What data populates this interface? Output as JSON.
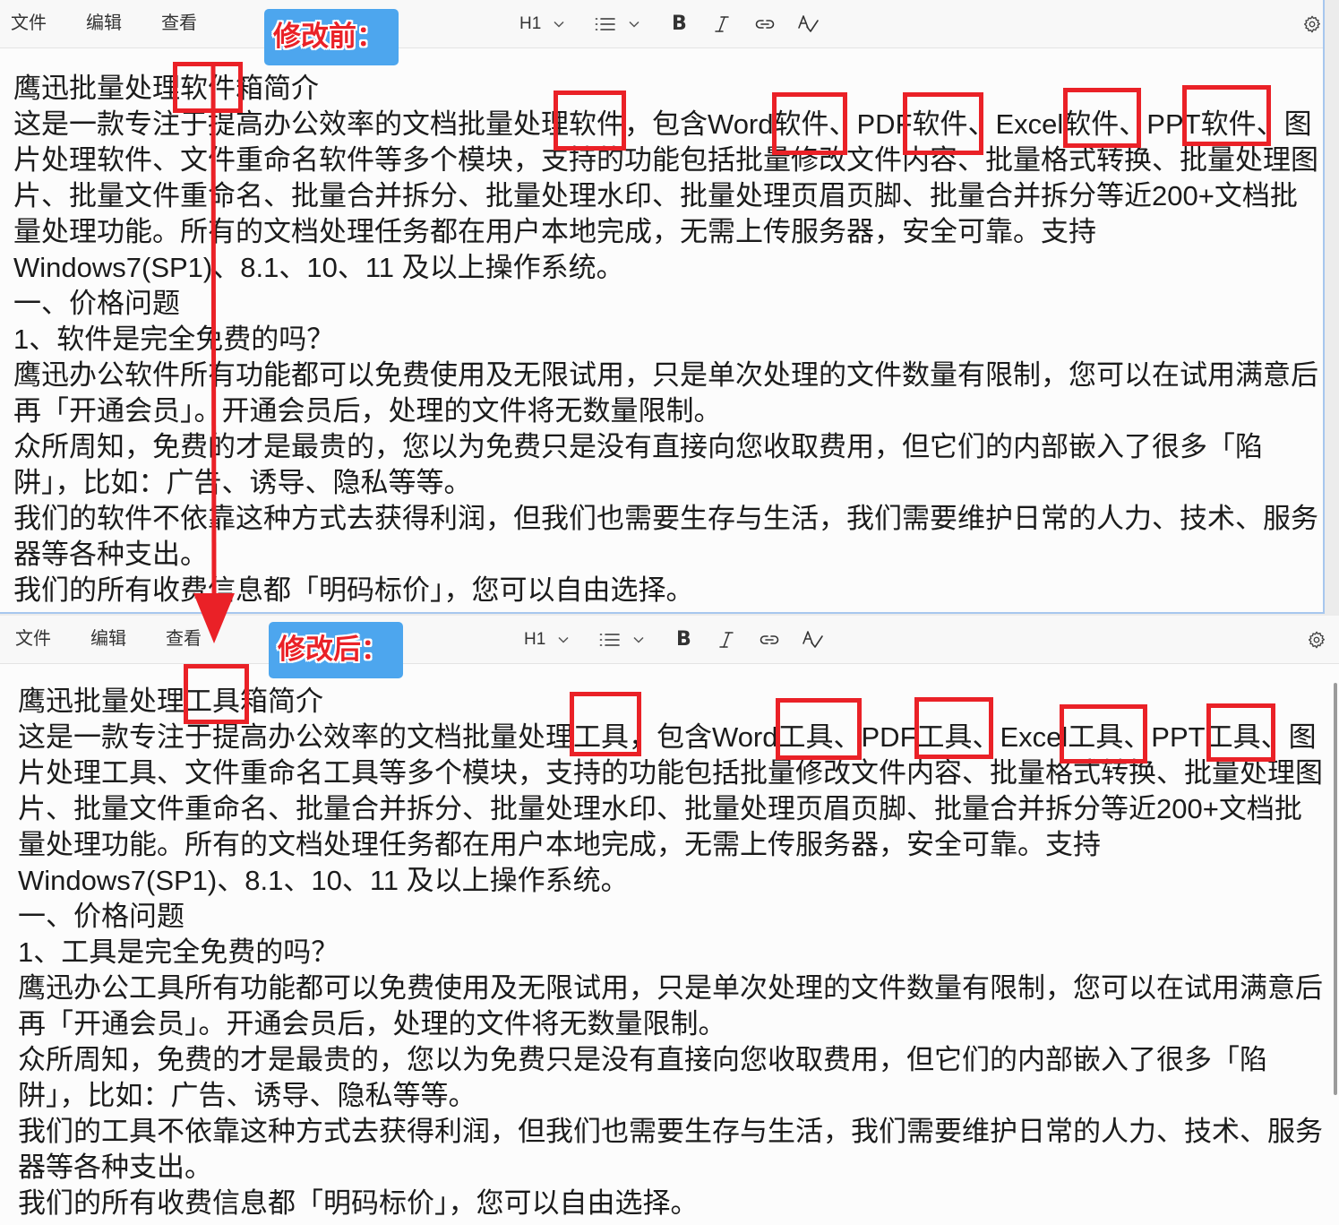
{
  "editor_chrome": {
    "menu": [
      "文件",
      "编辑",
      "查看"
    ],
    "heading_select": "H1",
    "bold_glyph": "B"
  },
  "icons": {
    "heading_dropdown": "chevron-down-icon",
    "list": "unordered-list-icon",
    "list_dropdown": "chevron-down-icon",
    "italic": "italic-icon",
    "link": "link-icon",
    "spellcheck": "spellcheck-icon",
    "settings": "gear-icon"
  },
  "colors": {
    "annotation_red": "#ea2127",
    "label_blue": "#4da6ee",
    "window_frame": "#a7c7ee"
  },
  "before": {
    "label": "修改前：",
    "lines": [
      "鹰迅批量处理软件箱简介",
      "这是一款专注于提高办公效率的文档批量处理软件，包含Word软件、PDF软件、Excel软件、PPT软件、图",
      "片处理软件、文件重命名软件等多个模块，支持的功能包括批量修改文件内容、批量格式转换、批量处理图",
      "片、批量文件重命名、批量合并拆分、批量处理水印、批量处理页眉页脚、批量合并拆分等近200+文档批",
      "量处理功能。所有的文档处理任务都在用户本地完成，无需上传服务器，安全可靠。支持",
      "Windows7(SP1)、8.1、10、11 及以上操作系统。",
      "一、价格问题",
      "1、软件是完全免费的吗？",
      "鹰迅办公软件所有功能都可以免费使用及无限试用，只是单次处理的文件数量有限制，您可以在试用满意后",
      "再「开通会员」。开通会员后，处理的文件将无数量限制。",
      "众所周知，免费的才是最贵的，您以为免费只是没有直接向您收取费用，但它们的内部嵌入了很多「陷",
      "阱」，比如：广告、诱导、隐私等等。",
      "我们的软件不依靠这种方式去获得利润，但我们也需要生存与生活，我们需要维护日常的人力、技术、服务",
      "器等各种支出。",
      "我们的所有收费信息都「明码标价」，您可以自由选择。"
    ]
  },
  "after": {
    "label": "修改后：",
    "lines": [
      "鹰迅批量处理工具箱简介",
      "这是一款专注于提高办公效率的文档批量处理工具，包含Word工具、PDF工具、Excel工具、PPT工具、图",
      "片处理工具、文件重命名工具等多个模块，支持的功能包括批量修改文件内容、批量格式转换、批量处理图",
      "片、批量文件重命名、批量合并拆分、批量处理水印、批量处理页眉页脚、批量合并拆分等近200+文档批",
      "量处理功能。所有的文档处理任务都在用户本地完成，无需上传服务器，安全可靠。支持",
      "Windows7(SP1)、8.1、10、11 及以上操作系统。",
      "一、价格问题",
      "1、工具是完全免费的吗？",
      "鹰迅办公工具所有功能都可以免费使用及无限试用，只是单次处理的文件数量有限制，您可以在试用满意后",
      "再「开通会员」。开通会员后，处理的文件将无数量限制。",
      "众所周知，免费的才是最贵的，您以为免费只是没有直接向您收取费用，但它们的内部嵌入了很多「陷",
      "阱」，比如：广告、诱导、隐私等等。",
      "我们的工具不依靠这种方式去获得利润，但我们也需要生存与生活，我们需要维护日常的人力、技术、服务",
      "器等各种支出。",
      "我们的所有收费信息都「明码标价」，您可以自由选择。"
    ]
  }
}
